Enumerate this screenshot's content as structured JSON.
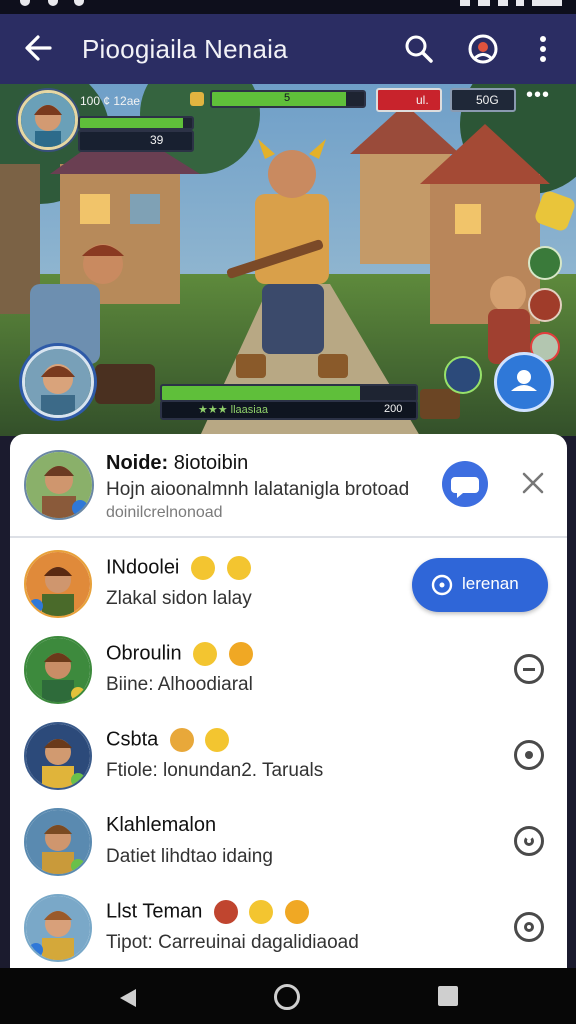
{
  "app": {
    "title": "Pioogiaila Nenaia"
  },
  "hud": {
    "player_stats": "100 ¢ 12ae",
    "player_sub": "39",
    "top_mid": "5",
    "red_badge": "ul.",
    "counter": "50G",
    "bottom_bar_label": "★★★ llaasiaa",
    "bottom_bar_value": "200"
  },
  "chat_header": {
    "name_prefix": "Noide:",
    "name_rest": "8iotoibin",
    "line1": "Hojn aioonalmnh lalatanigla brotoad",
    "line2": "doinilcrelnonoad"
  },
  "friends": [
    {
      "name": "INdoolei",
      "status": "Zlakal sidon lalay",
      "action": "lerenan"
    },
    {
      "name": "Obroulin",
      "status": "Biine: Alhoodiaral"
    },
    {
      "name": "Csbta",
      "status": "Ftiole: lonundan2. Taruals"
    },
    {
      "name": "Klahlemalon",
      "status": "Datiet lihdtao idaing"
    },
    {
      "name": "Llst Teman",
      "status": "Tipot: Carreuinai dagalidiaoad"
    }
  ],
  "colors": {
    "appbar": "#2b2d63",
    "accent": "#3b6fd6"
  }
}
